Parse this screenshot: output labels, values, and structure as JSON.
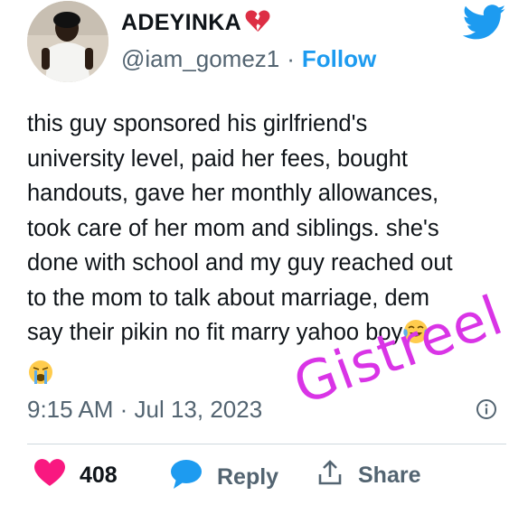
{
  "author": {
    "display_name": "ADEYINKA",
    "handle": "@iam_gomez1",
    "separator": "·",
    "follow_label": "Follow"
  },
  "tweet": {
    "lines": [
      "this guy sponsored his girlfriend's",
      "university level, paid her fees, bought",
      "handouts, gave her monthly allowances,",
      "took care of her mom and siblings. she's",
      "done with school and my guy reached out",
      "to the mom to talk about marriage, dem",
      "say their pikin no fit marry yahoo boy"
    ],
    "timestamp": "9:15 AM · Jul 13, 2023"
  },
  "actions": {
    "like_count": "408",
    "reply_label": "Reply",
    "share_label": "Share"
  },
  "watermark": "Gistreel",
  "icons": {
    "name_suffix": "broken-heart-icon",
    "logo": "twitter-bird-icon",
    "info": "info-icon",
    "like": "heart-icon",
    "reply": "speech-bubble-icon",
    "share": "share-upload-icon",
    "emoji_laugh": "tears-of-joy-emoji",
    "emoji_cry": "loudly-crying-emoji"
  },
  "colors": {
    "brand_blue": "#1d9bf0",
    "like_pink": "#f91880",
    "text_gray": "#536471",
    "watermark_magenta": "#d934e6"
  }
}
